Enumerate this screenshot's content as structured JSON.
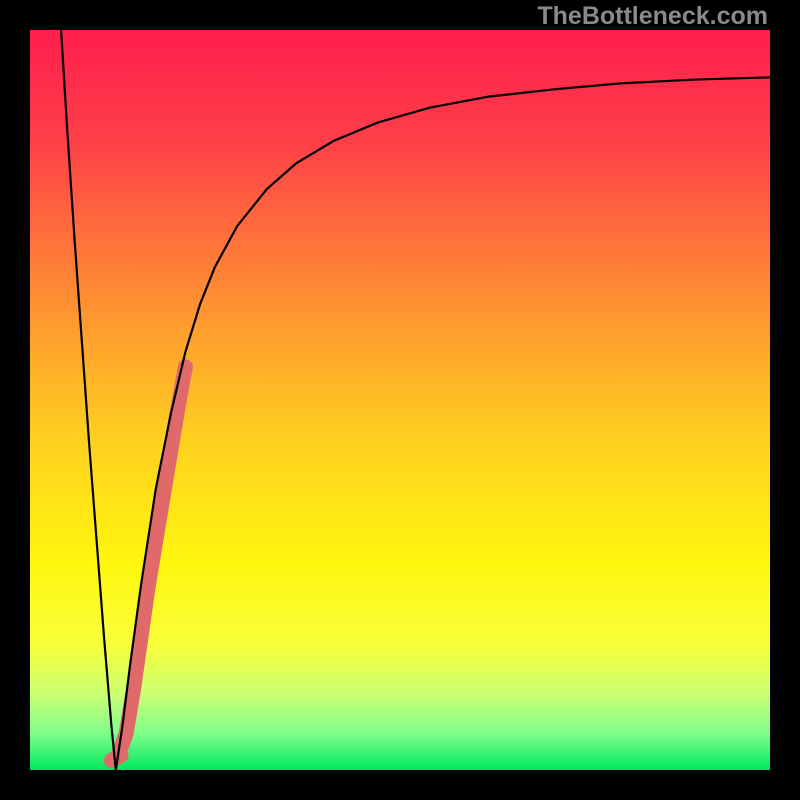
{
  "watermark": "TheBottleneck.com",
  "chart_data": {
    "type": "line",
    "title": "",
    "xlabel": "",
    "ylabel": "",
    "xlim": [
      0,
      100
    ],
    "ylim": [
      0,
      100
    ],
    "grid": false,
    "gradient_stops": [
      {
        "pos": 0.0,
        "color": "#ff1e4e"
      },
      {
        "pos": 0.15,
        "color": "#ff3f48"
      },
      {
        "pos": 0.35,
        "color": "#ff8a34"
      },
      {
        "pos": 0.55,
        "color": "#ffcf20"
      },
      {
        "pos": 0.72,
        "color": "#fff60e"
      },
      {
        "pos": 0.83,
        "color": "#f8ff3a"
      },
      {
        "pos": 0.9,
        "color": "#c8ff74"
      },
      {
        "pos": 0.95,
        "color": "#7fff8c"
      },
      {
        "pos": 1.0,
        "color": "#00e85e"
      }
    ],
    "series": [
      {
        "name": "main-curve",
        "color": "#000000",
        "width": 2.2,
        "x": [
          4.2,
          5.0,
          6.0,
          7.0,
          8.0,
          9.0,
          10.0,
          11.0,
          11.6,
          12.5,
          13.5,
          15.0,
          17.0,
          19.0,
          21.0,
          23.0,
          25.0,
          28.0,
          32.0,
          36.0,
          41.0,
          47.0,
          54.0,
          62.0,
          71.0,
          80.0,
          90.0,
          100.0
        ],
        "y": [
          100.0,
          87.0,
          72.0,
          58.0,
          44.0,
          31.0,
          18.0,
          6.0,
          0.0,
          6.0,
          14.0,
          25.0,
          38.0,
          48.0,
          56.5,
          63.0,
          68.0,
          73.5,
          78.5,
          82.0,
          85.0,
          87.5,
          89.5,
          91.0,
          92.0,
          92.8,
          93.3,
          93.6
        ]
      },
      {
        "name": "highlight-band",
        "color": "#e06a6a",
        "width": 15,
        "x": [
          11.9,
          12.3,
          13.0,
          14.0,
          15.0,
          16.0,
          17.0,
          18.0,
          19.0,
          20.0,
          21.0
        ],
        "y": [
          2.0,
          3.0,
          5.0,
          11.0,
          18.0,
          25.0,
          31.0,
          37.0,
          43.0,
          49.0,
          54.5
        ]
      },
      {
        "name": "vertex-dot",
        "color": "#e06a6a",
        "width": 15,
        "x": [
          11.0,
          12.3
        ],
        "y": [
          1.3,
          2.0
        ]
      }
    ]
  }
}
